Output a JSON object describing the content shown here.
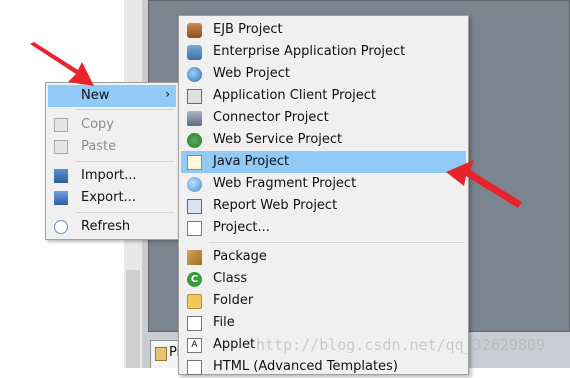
{
  "context_menu": {
    "items": [
      {
        "label": "New",
        "icon": "new-icon",
        "has_submenu": true,
        "highlighted": true,
        "enabled": true
      },
      {
        "label": "Copy",
        "icon": "copy-icon",
        "enabled": false
      },
      {
        "label": "Paste",
        "icon": "paste-icon",
        "enabled": false
      },
      {
        "label": "Import...",
        "icon": "import-icon",
        "enabled": true
      },
      {
        "label": "Export...",
        "icon": "export-icon",
        "enabled": true
      },
      {
        "label": "Refresh",
        "icon": "refresh-icon",
        "enabled": true
      }
    ],
    "submenu_arrow": "›"
  },
  "new_submenu": {
    "items": [
      {
        "label": "EJB Project",
        "icon": "ejb-project-icon"
      },
      {
        "label": "Enterprise Application Project",
        "icon": "enterprise-application-project-icon"
      },
      {
        "label": "Web Project",
        "icon": "web-project-icon"
      },
      {
        "label": "Application Client Project",
        "icon": "application-client-project-icon"
      },
      {
        "label": "Connector Project",
        "icon": "connector-project-icon"
      },
      {
        "label": "Web Service Project",
        "icon": "web-service-project-icon"
      },
      {
        "label": "Java Project",
        "icon": "java-project-icon",
        "highlighted": true
      },
      {
        "label": "Web Fragment Project",
        "icon": "web-fragment-project-icon"
      },
      {
        "label": "Report Web Project",
        "icon": "report-web-project-icon"
      },
      {
        "label": "Project...",
        "icon": "project-icon"
      },
      {
        "label": "Package",
        "icon": "package-icon"
      },
      {
        "label": "Class",
        "icon": "class-icon"
      },
      {
        "label": "Folder",
        "icon": "folder-icon"
      },
      {
        "label": "File",
        "icon": "file-icon"
      },
      {
        "label": "Applet",
        "icon": "applet-icon"
      },
      {
        "label": "HTML (Advanced Templates)",
        "icon": "html-icon"
      }
    ]
  },
  "bottom_tab": {
    "label": "Pi"
  },
  "watermark": "http://blog.csdn.net/qq_32629809",
  "colors": {
    "highlight": "#91c9f7",
    "menu_background": "#f0f0f0",
    "annotation_arrow": "#e8232a",
    "editor_background": "#7b8590"
  }
}
